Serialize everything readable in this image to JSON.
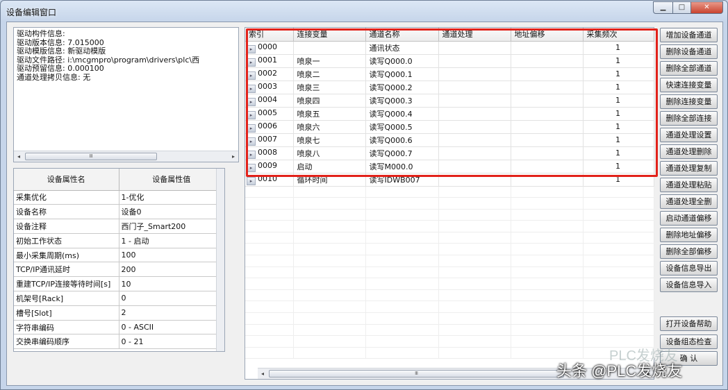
{
  "window": {
    "title": "设备编辑窗口",
    "min_label": "▁",
    "max_label": "□",
    "close_label": "✕"
  },
  "driver_info": {
    "lines": [
      "驱动构件信息:",
      "驱动版本信息: 7.015000",
      "驱动模版信息: 新驱动模版",
      "驱动文件路径: i:\\mcgmpro\\program\\drivers\\plc\\西",
      "驱动预留信息: 0.000100",
      "通道处理拷贝信息: 无"
    ]
  },
  "properties": {
    "header_name": "设备属性名",
    "header_value": "设备属性值",
    "rows": [
      {
        "name": "采集优化",
        "value": "1-优化"
      },
      {
        "name": "设备名称",
        "value": "设备0"
      },
      {
        "name": "设备注释",
        "value": "西门子_Smart200"
      },
      {
        "name": "初始工作状态",
        "value": "1 - 启动"
      },
      {
        "name": "最小采集周期(ms)",
        "value": "100"
      },
      {
        "name": "TCP/IP通讯延时",
        "value": "200"
      },
      {
        "name": "重建TCP/IP连接等待时间[s]",
        "value": "10"
      },
      {
        "name": "机架号[Rack]",
        "value": "0"
      },
      {
        "name": "槽号[Slot]",
        "value": "2"
      },
      {
        "name": "字符串编码",
        "value": "0 - ASCII"
      },
      {
        "name": "交换串编码顺序",
        "value": "0 - 21"
      }
    ]
  },
  "channels": {
    "columns": [
      "索引",
      "连接变量",
      "通道名称",
      "通道处理",
      "地址偏移",
      "采集频次"
    ],
    "rows": [
      {
        "index": "0000",
        "var": "",
        "name": "通讯状态",
        "proc": "",
        "offset": "",
        "rate": "1"
      },
      {
        "index": "0001",
        "var": "喷泉一",
        "name": "读写Q000.0",
        "proc": "",
        "offset": "",
        "rate": "1"
      },
      {
        "index": "0002",
        "var": "喷泉二",
        "name": "读写Q000.1",
        "proc": "",
        "offset": "",
        "rate": "1"
      },
      {
        "index": "0003",
        "var": "喷泉三",
        "name": "读写Q000.2",
        "proc": "",
        "offset": "",
        "rate": "1"
      },
      {
        "index": "0004",
        "var": "喷泉四",
        "name": "读写Q000.3",
        "proc": "",
        "offset": "",
        "rate": "1"
      },
      {
        "index": "0005",
        "var": "喷泉五",
        "name": "读写Q000.4",
        "proc": "",
        "offset": "",
        "rate": "1"
      },
      {
        "index": "0006",
        "var": "喷泉六",
        "name": "读写Q000.5",
        "proc": "",
        "offset": "",
        "rate": "1"
      },
      {
        "index": "0007",
        "var": "喷泉七",
        "name": "读写Q000.6",
        "proc": "",
        "offset": "",
        "rate": "1"
      },
      {
        "index": "0008",
        "var": "喷泉八",
        "name": "读写Q000.7",
        "proc": "",
        "offset": "",
        "rate": "1"
      },
      {
        "index": "0009",
        "var": "启动",
        "name": "读写M000.0",
        "proc": "",
        "offset": "",
        "rate": "1"
      },
      {
        "index": "0010",
        "var": "循环时间",
        "name": "读写IDWB007",
        "proc": "",
        "offset": "",
        "rate": "1"
      }
    ]
  },
  "buttons": [
    "增加设备通道",
    "删除设备通道",
    "删除全部通道",
    "快速连接变量",
    "删除连接变量",
    "删除全部连接",
    "通道处理设置",
    "通道处理删除",
    "通道处理复制",
    "通道处理粘贴",
    "通道处理全删",
    "启动通道偏移",
    "删除地址偏移",
    "删除全部偏移",
    "设备信息导出",
    "设备信息导入",
    "打开设备帮助",
    "设备组态检查",
    "确    认"
  ],
  "scroll_thumb_label": "Ⅲ",
  "watermark": {
    "main": "头条 @PLC发烧友",
    "faint": "PLC发烧友"
  },
  "colors": {
    "highlight": "#e2221a"
  }
}
